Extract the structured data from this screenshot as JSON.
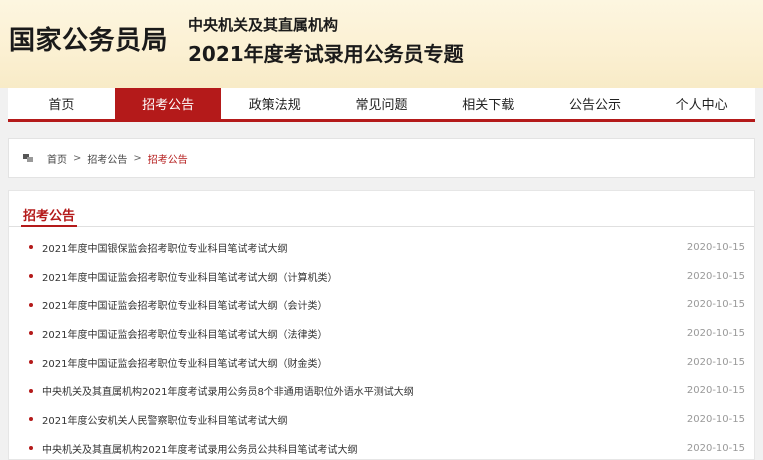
{
  "header": {
    "site_title": "国家公务员局",
    "sub_org": "中央机关及其直属机构",
    "sub_topic": "2021年度考试录用公务员专题"
  },
  "nav": {
    "items": [
      "首页",
      "招考公告",
      "政策法规",
      "常见问题",
      "相关下载",
      "公告公示",
      "个人中心"
    ],
    "active": "招考公告"
  },
  "breadcrumb": {
    "home": "首页",
    "parent": "招考公告",
    "current": "招考公告",
    "separator": ">"
  },
  "section": {
    "title": "招考公告",
    "items": [
      {
        "title": "2021年度中国银保监会招考职位专业科目笔试考试大纲",
        "date": "2020-10-15"
      },
      {
        "title": "2021年度中国证监会招考职位专业科目笔试考试大纲（计算机类）",
        "date": "2020-10-15"
      },
      {
        "title": "2021年度中国证监会招考职位专业科目笔试考试大纲（会计类）",
        "date": "2020-10-15"
      },
      {
        "title": "2021年度中国证监会招考职位专业科目笔试考试大纲（法律类）",
        "date": "2020-10-15"
      },
      {
        "title": "2021年度中国证监会招考职位专业科目笔试考试大纲（财金类）",
        "date": "2020-10-15"
      },
      {
        "title": "中央机关及其直属机构2021年度考试录用公务员8个非通用语职位外语水平测试大纲",
        "date": "2020-10-15"
      },
      {
        "title": "2021年度公安机关人民警察职位专业科目笔试考试大纲",
        "date": "2020-10-15"
      },
      {
        "title": "中央机关及其直属机构2021年度考试录用公务员公共科目笔试考试大纲",
        "date": "2020-10-15"
      }
    ]
  },
  "colors": {
    "accent": "#b41a1a",
    "header_bg": "#fbf0d2"
  }
}
